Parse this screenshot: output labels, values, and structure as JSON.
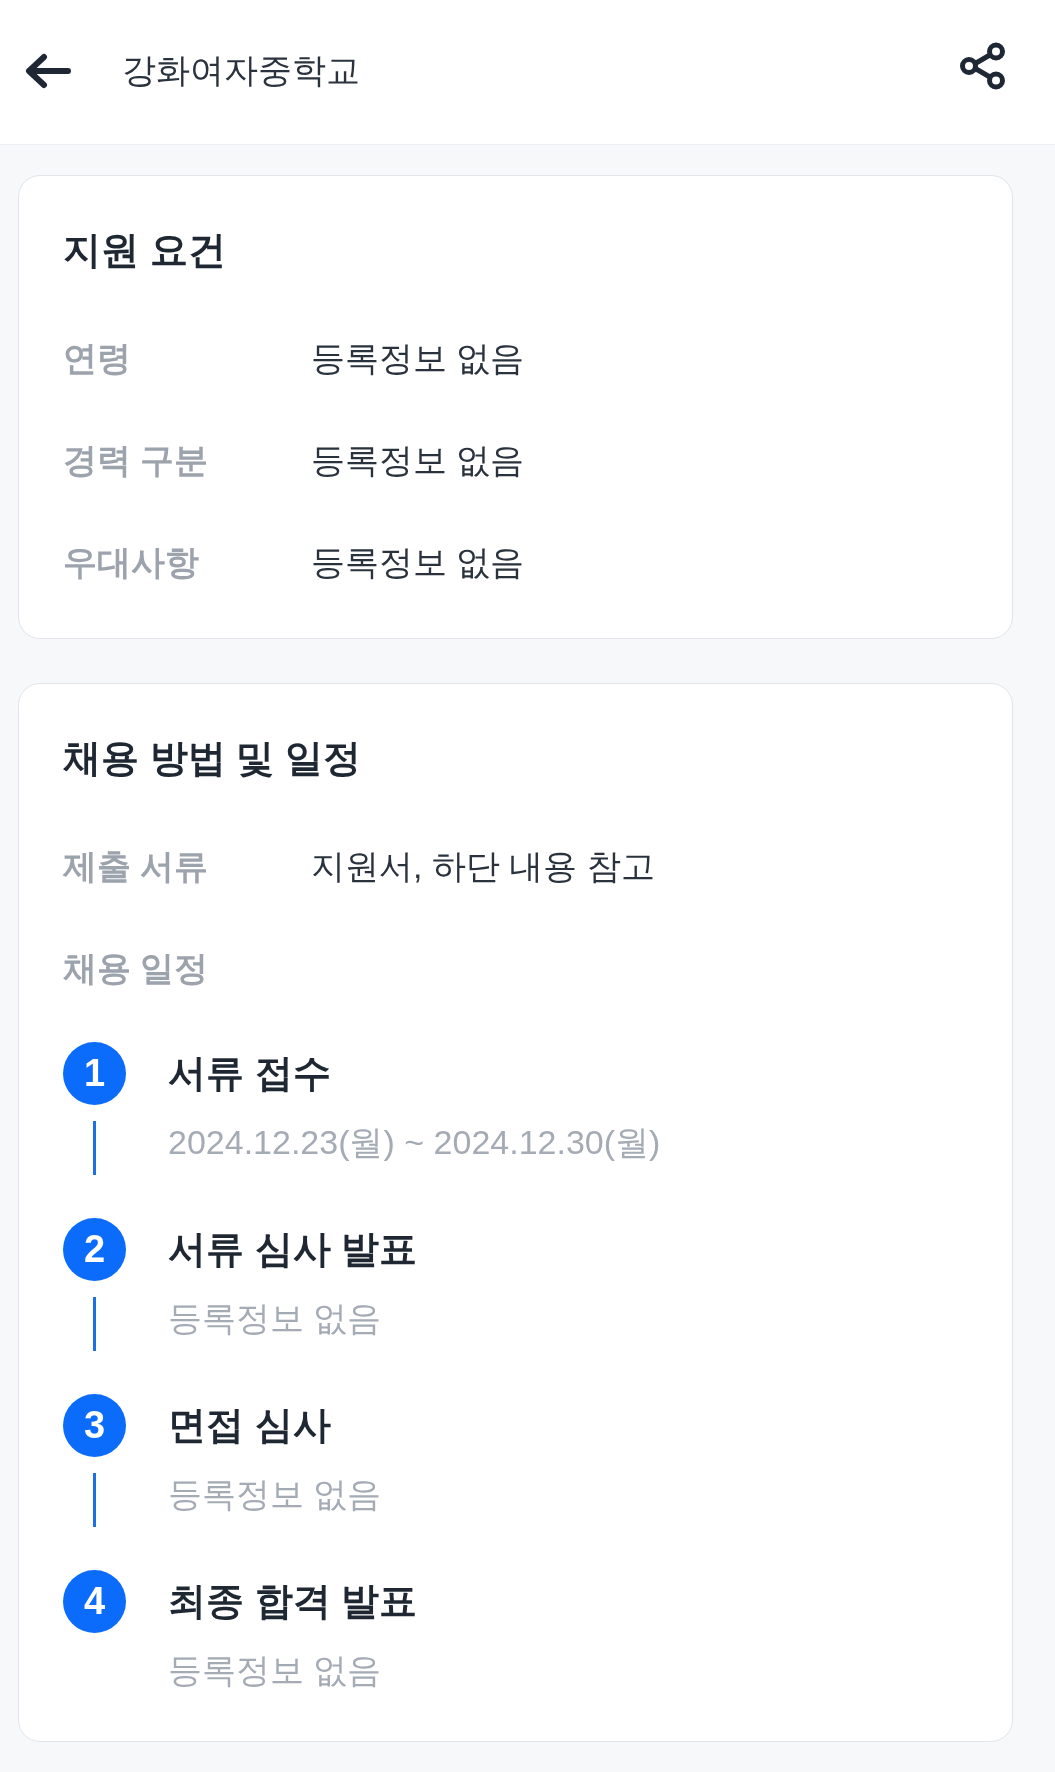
{
  "header": {
    "title": "강화여자중학교"
  },
  "sections": [
    {
      "title": "지원 요건",
      "rows": [
        {
          "label": "연령",
          "value": "등록정보 없음"
        },
        {
          "label": "경력 구분",
          "value": "등록정보 없음"
        },
        {
          "label": "우대사항",
          "value": "등록정보 없음"
        }
      ]
    },
    {
      "title": "채용 방법 및 일정",
      "rows": [
        {
          "label": "제출 서류",
          "value": "지원서, 하단 내용 참고"
        }
      ],
      "schedule": {
        "label": "채용 일정",
        "steps": [
          {
            "number": "1",
            "title": "서류 접수",
            "detail": "2024.12.23(월) ~ 2024.12.30(월)"
          },
          {
            "number": "2",
            "title": "서류 심사 발표",
            "detail": "등록정보 없음"
          },
          {
            "number": "3",
            "title": "면접 심사",
            "detail": "등록정보 없음"
          },
          {
            "number": "4",
            "title": "최종 합격 발표",
            "detail": "등록정보 없음"
          }
        ]
      }
    }
  ]
}
